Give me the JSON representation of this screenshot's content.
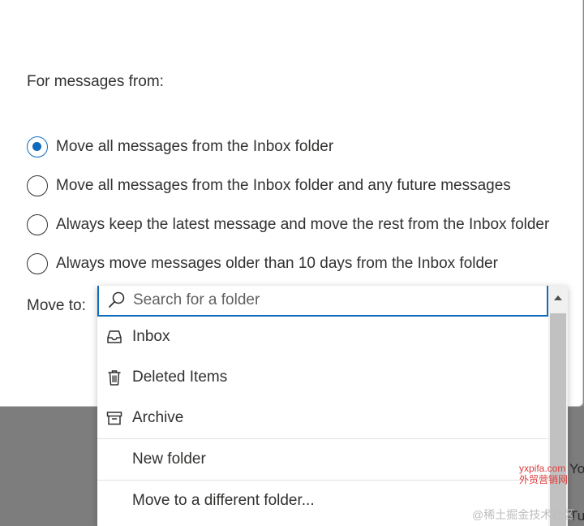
{
  "dialog": {
    "section_label": "For messages from:",
    "options": [
      {
        "label": "Move all messages from the Inbox folder",
        "checked": true
      },
      {
        "label": "Move all messages from the Inbox folder and any future messages",
        "checked": false
      },
      {
        "label": "Always keep the latest message and move the rest from the Inbox folder",
        "checked": false
      },
      {
        "label": "Always move messages older than 10 days from the Inbox folder",
        "checked": false
      }
    ],
    "move_to_label": "Move to:"
  },
  "dropdown": {
    "search_placeholder": "Search for a folder",
    "search_value": "",
    "items": [
      {
        "label": "Inbox",
        "icon": "inbox-icon"
      },
      {
        "label": "Deleted Items",
        "icon": "trash-icon"
      },
      {
        "label": "Archive",
        "icon": "archive-icon"
      }
    ],
    "actions": [
      {
        "label": "New folder"
      },
      {
        "label": "Move to a different folder..."
      }
    ]
  },
  "background": {
    "partial_text_1": "Yo",
    "partial_text_2": "Tu"
  },
  "watermark": {
    "line1": "yxpifa.com",
    "line2": "外贸营销网",
    "line3": "@稀土掘金技术社区"
  },
  "colors": {
    "accent": "#0f6cbd",
    "text": "#323130",
    "overlay": "#8a8a8a"
  }
}
